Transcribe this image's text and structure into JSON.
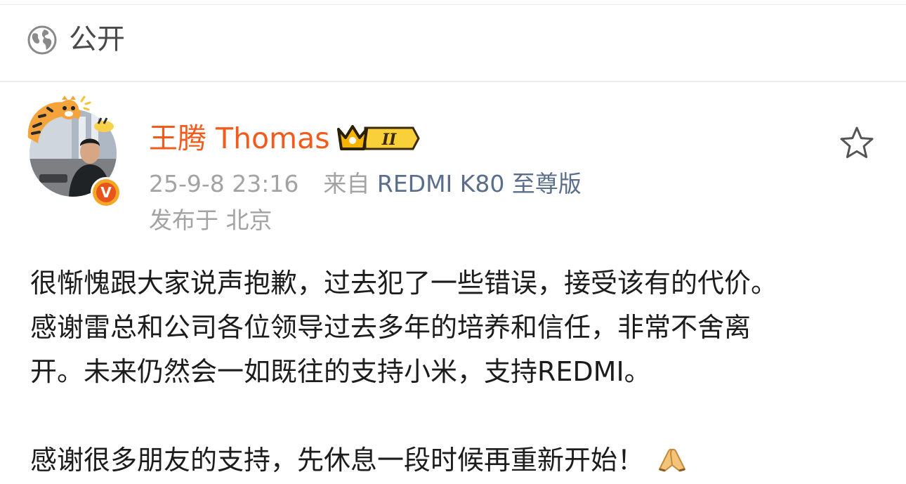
{
  "visibility": {
    "icon": "globe-icon",
    "label": "公开"
  },
  "author": {
    "name": "王腾 Thomas",
    "badge_icon": "crown-badge-icon",
    "badge_text": "II",
    "verified_icon": "verified-v-icon",
    "verified_text": "V"
  },
  "meta": {
    "timestamp": "25-9-8 23:16",
    "source_prefix": "来自",
    "device": "REDMI K80 至尊版",
    "location": "发布于 北京"
  },
  "actions": {
    "favorite_icon": "star-outline-icon"
  },
  "post": {
    "lines": [
      "很惭愧跟大家说声抱歉，过去犯了一些错误，接受该有的代价。",
      "感谢雷总和公司各位领导过去多年的培养和信任，非常不舍离",
      "开。未来仍然会一如既往的支持小米，支持REDMI。"
    ],
    "last_line": "感谢很多朋友的支持，先休息一段时候再重新开始！",
    "emoji": "folded-hands-icon"
  },
  "colors": {
    "username": "#f25b1b",
    "meta_gray": "#a3a3a3",
    "device_link": "#5a6e8c",
    "body_text": "#1c1c1c",
    "badge_gold": "#f5b400"
  }
}
